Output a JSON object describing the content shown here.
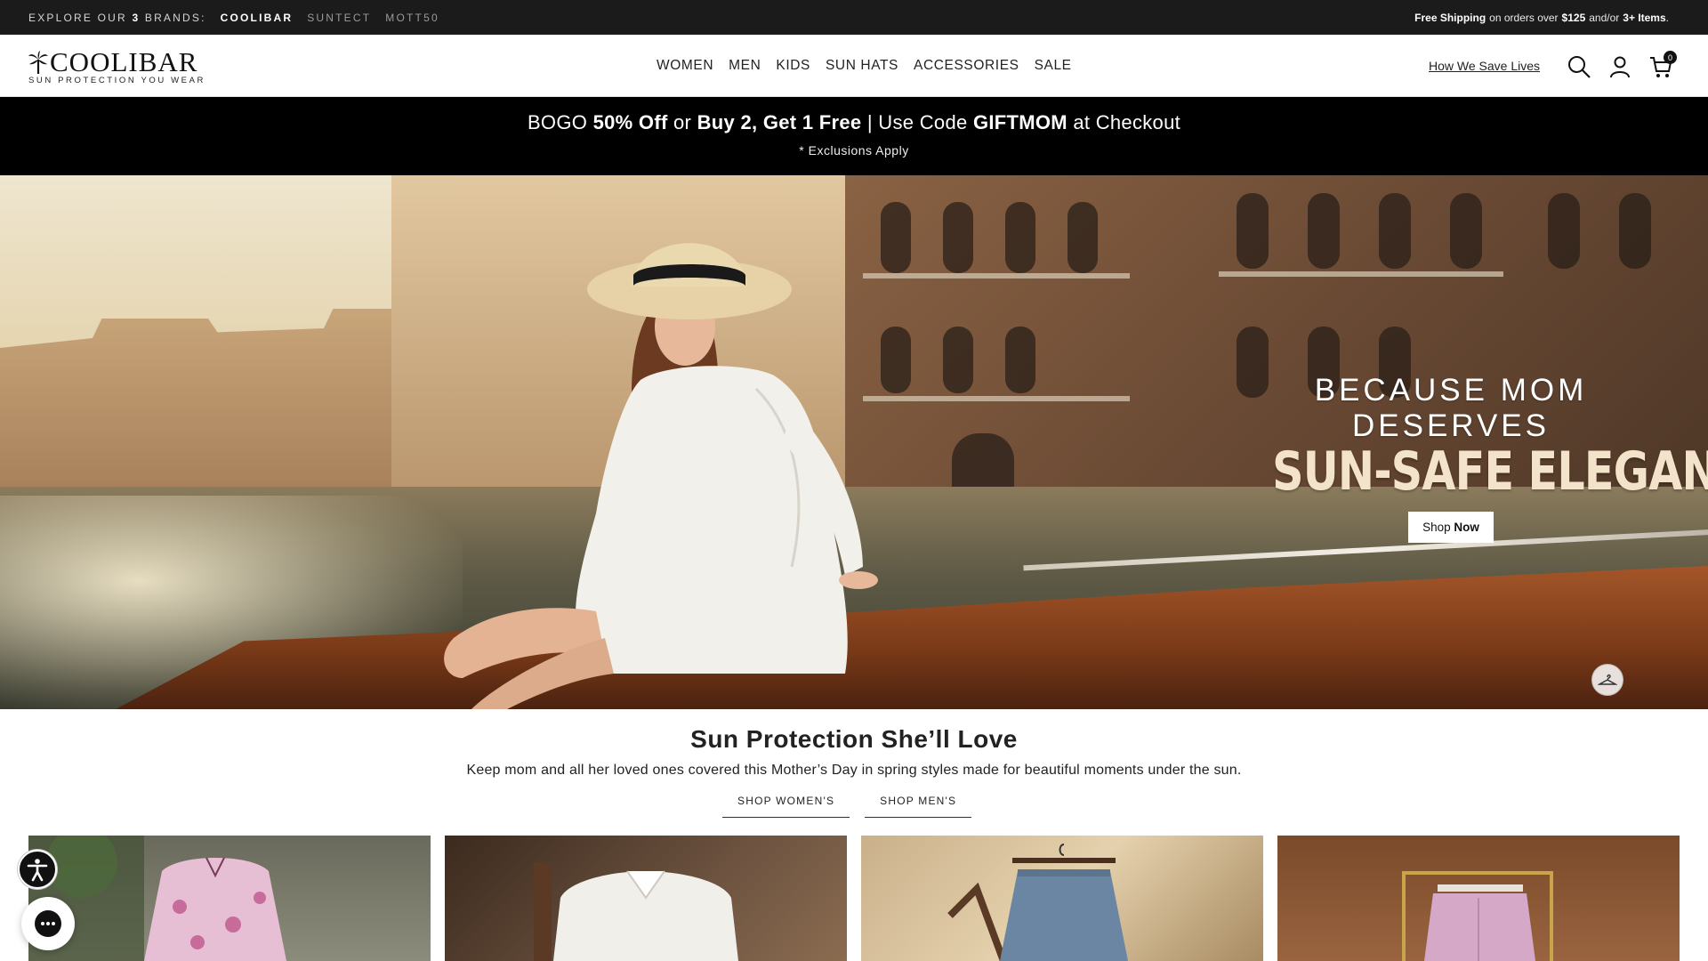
{
  "topbar": {
    "explore_prefix": "EXPLORE OUR",
    "explore_count": "3",
    "explore_suffix": "BRANDS:",
    "brands": [
      "COOLIBAR",
      "SUNTECT",
      "MOTT50"
    ],
    "shipping": {
      "free": "Free Shipping",
      "text1": "on orders over",
      "amount": "$125",
      "text2": "and/or",
      "items": "3+ Items",
      "end": "."
    }
  },
  "header": {
    "logo_word": "COOLIBAR",
    "logo_tagline": "SUN PROTECTION YOU WEAR",
    "nav": [
      "WOMEN",
      "MEN",
      "KIDS",
      "SUN HATS",
      "ACCESSORIES",
      "SALE"
    ],
    "how_we_save": "How We Save Lives",
    "cart_count": "0",
    "icons": [
      "search-icon",
      "account-icon",
      "cart-icon"
    ]
  },
  "promo": {
    "p1": "BOGO",
    "p2": "50% Off",
    "p3": "or",
    "p4": "Buy 2, Get 1 Free",
    "p5": "| Use Code",
    "p6": "GIFTMOM",
    "p7": "at Checkout",
    "sub": "* Exclusions Apply"
  },
  "hero": {
    "pre": "BECAUSE MOM DESERVES",
    "main": "SUN-SAFE ELEGANCE",
    "cta_regular": "Shop",
    "cta_bold": "Now"
  },
  "section": {
    "title": "Sun Protection She’ll Love",
    "desc": "Keep mom and all her loved ones covered this Mother’s Day in spring styles made for beautiful moments under the sun.",
    "tabs": [
      "SHOP WOMEN'S",
      "SHOP MEN'S"
    ]
  },
  "colors": {
    "topbar_bg": "#1b1b1b",
    "promo_bg": "#000000",
    "hero_accent": "#f4e3cb"
  }
}
